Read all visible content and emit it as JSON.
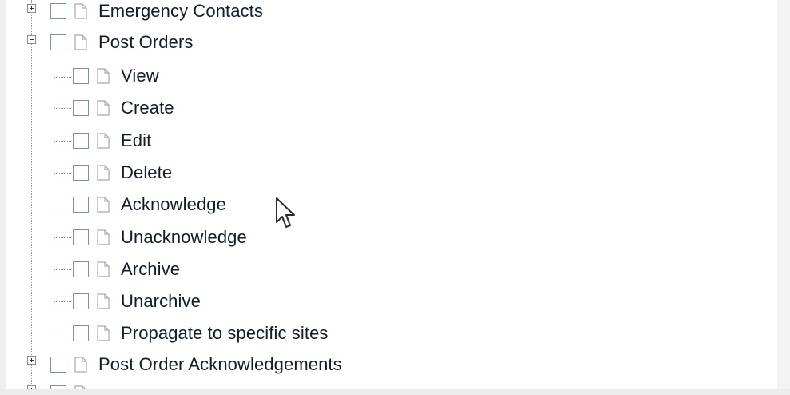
{
  "tree": {
    "nodes": [
      {
        "label": "Emergency Contacts",
        "expander": "plus",
        "level": 0
      },
      {
        "label": "Post Orders",
        "expander": "minus",
        "level": 0,
        "children": [
          {
            "label": "View"
          },
          {
            "label": "Create"
          },
          {
            "label": "Edit"
          },
          {
            "label": "Delete"
          },
          {
            "label": "Acknowledge"
          },
          {
            "label": "Unacknowledge"
          },
          {
            "label": "Archive"
          },
          {
            "label": "Unarchive"
          },
          {
            "label": "Propagate to specific sites"
          }
        ]
      },
      {
        "label": "Post Order Acknowledgements",
        "expander": "plus",
        "level": 0
      }
    ]
  },
  "icons": {
    "expander_plus": "plus-square-icon",
    "expander_minus": "minus-square-icon",
    "checkbox": "checkbox-icon",
    "document": "document-icon",
    "cursor": "mouse-pointer-icon"
  },
  "colors": {
    "label_text": "#121c2e",
    "checkbox_border": "#7f8fa3",
    "tree_line": "#9a9a9a",
    "panel_background": "#ffffff",
    "frame_background": "#efefef"
  }
}
